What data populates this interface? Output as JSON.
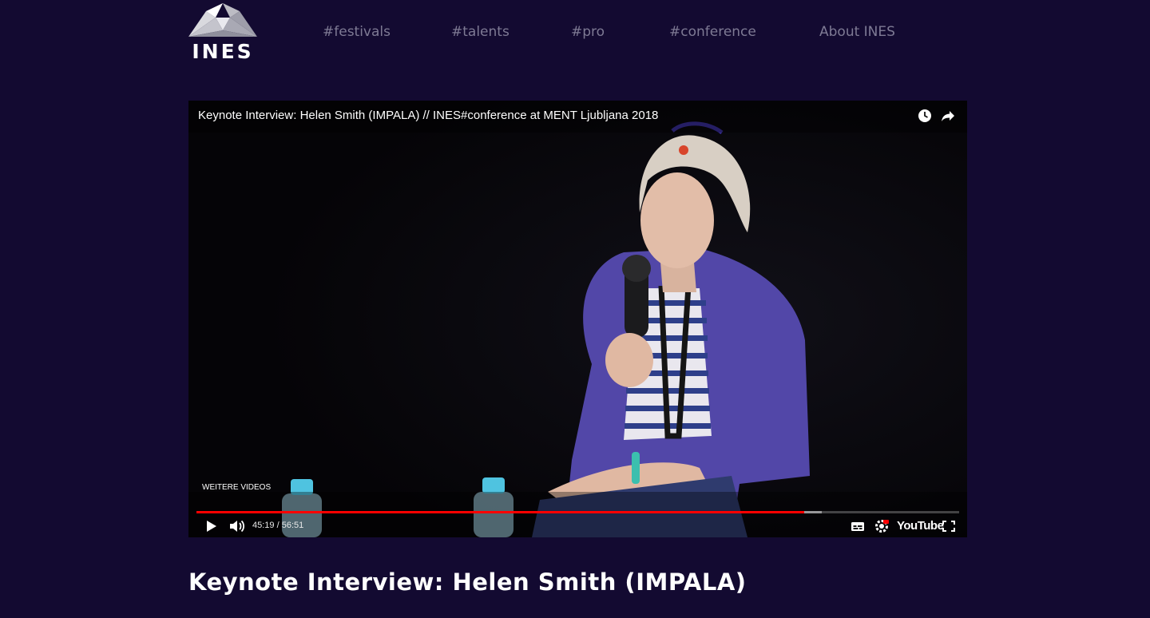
{
  "brand": {
    "logo_text": "INES"
  },
  "nav": {
    "items": [
      {
        "label": "#festivals"
      },
      {
        "label": "#talents"
      },
      {
        "label": "#pro"
      },
      {
        "label": "#conference"
      },
      {
        "label": "About INES"
      }
    ]
  },
  "video": {
    "title": "Keynote Interview: Helen Smith (IMPALA) // INES#conference at MENT Ljubljana 2018",
    "more_videos_label": "WEITERE VIDEOS",
    "current_time": "45:19",
    "time_separator": " / ",
    "duration": "56:51",
    "progress_fraction": 0.797,
    "buffered_fraction": 0.82,
    "platform_label": "YouTube",
    "icons": {
      "watch_later": "clock-icon",
      "share": "share-icon",
      "play": "play-icon",
      "volume": "volume-icon",
      "subtitles": "subtitles-icon",
      "settings": "settings-gear-icon",
      "fullscreen": "fullscreen-icon"
    },
    "colors": {
      "progress": "#ff0000"
    }
  },
  "page": {
    "heading": "Keynote Interview: Helen Smith (IMPALA)"
  },
  "colors": {
    "background": "#130a31",
    "nav_text": "#7e7a94",
    "heading": "#ffffff"
  }
}
